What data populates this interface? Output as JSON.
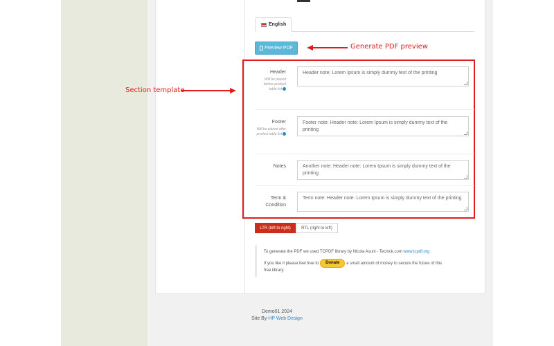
{
  "tab": {
    "label": "English"
  },
  "preview_button": {
    "label": "Preview PDF"
  },
  "annotations": {
    "generate_preview": "Generate PDF preview",
    "section_template": "Section template"
  },
  "fields": [
    {
      "label": "Header",
      "help": "Will be placed before product table list",
      "value": "Header note: Lorem Ipsum is simply dummy text of the printing"
    },
    {
      "label": "Footer",
      "help": "Will be placed after product table list",
      "value": "Footer note: Header note: Lorem Ipsum is simply dummy text of the printing"
    },
    {
      "label": "Notes",
      "help": "",
      "value": "Another note: Header note: Lorem Ipsum is simply dummy text of the printing"
    },
    {
      "label": "Term &",
      "label2": "Condition",
      "help": "",
      "value": "Term note: Header note: Lorem Ipsum is simply dummy text of the printing"
    }
  ],
  "direction": {
    "ltr": "LTR (left to right)",
    "rtl": "RTL (right to left)"
  },
  "info": {
    "line1_prefix": "To generate the PDF we used TCPDF library by Nicola Asuni - Tecnick.com",
    "line1_link": "www.tcpdf.org",
    "line2_prefix": "If you like it please feel free to",
    "donate_label": "Donate",
    "line2_suffix": "a small amount of money to secure the future of this",
    "line3": "free library."
  },
  "footer": {
    "line1": "Demo01 2024",
    "site_by": "Site By",
    "link": "HP Web Design"
  },
  "colors": {
    "accent_red": "#e01b1b",
    "preview_btn": "#5cb8d6",
    "ltr_btn": "#cc2c1c",
    "link": "#2d87c9"
  }
}
